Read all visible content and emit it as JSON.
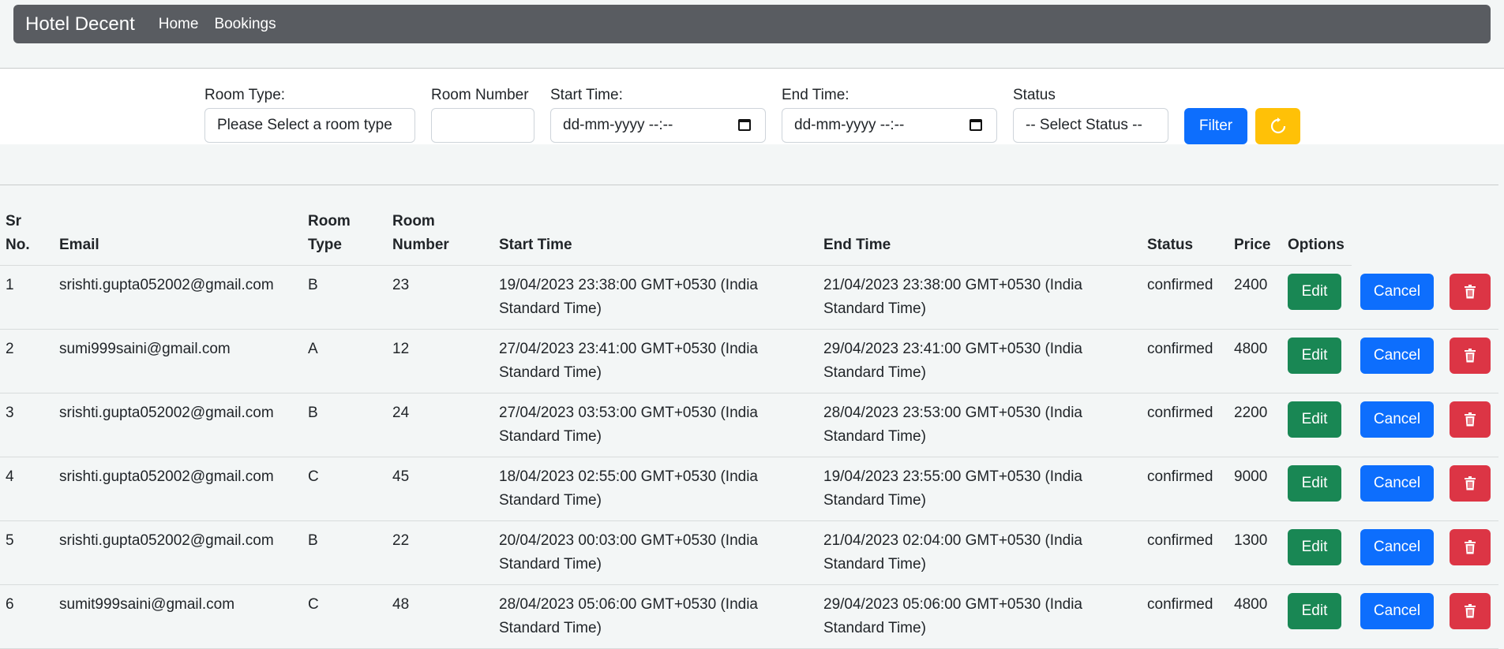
{
  "navbar": {
    "brand": "Hotel Decent",
    "links": [
      "Home",
      "Bookings"
    ]
  },
  "filters": {
    "room_type_label": "Room Type:",
    "room_type_placeholder": "Please Select a room type",
    "room_number_label": "Room Number",
    "room_number_value": "",
    "start_time_label": "Start Time:",
    "start_time_placeholder": "dd-mm-yyyy --:--",
    "end_time_label": "End Time:",
    "end_time_placeholder": "dd-mm-yyyy --:--",
    "status_label": "Status",
    "status_placeholder": "-- Select Status --",
    "filter_button": "Filter",
    "reset_icon": "refresh-icon"
  },
  "table": {
    "headers": {
      "sr_line1": "Sr",
      "sr_line2": "No.",
      "email": "Email",
      "room_type_line1": "Room",
      "room_type_line2": "Type",
      "room_number_line1": "Room",
      "room_number_line2": "Number",
      "start_time": "Start Time",
      "end_time": "End Time",
      "status": "Status",
      "price": "Price",
      "options": "Options"
    },
    "button_labels": {
      "edit": "Edit",
      "cancel": "Cancel",
      "delete_icon": "trash-icon"
    },
    "rows": [
      {
        "sr": "1",
        "email": "srishti.gupta052002@gmail.com",
        "room_type": "B",
        "room_number": "23",
        "start_line1": "19/04/2023 23:38:00 GMT+0530 (India",
        "start_line2": "Standard Time)",
        "end_line1": "21/04/2023 23:38:00 GMT+0530 (India",
        "end_line2": "Standard Time)",
        "status": "confirmed",
        "price": "2400"
      },
      {
        "sr": "2",
        "email": "sumi999saini@gmail.com",
        "room_type": "A",
        "room_number": "12",
        "start_line1": "27/04/2023 23:41:00 GMT+0530 (India",
        "start_line2": "Standard Time)",
        "end_line1": "29/04/2023 23:41:00 GMT+0530 (India",
        "end_line2": "Standard Time)",
        "status": "confirmed",
        "price": "4800"
      },
      {
        "sr": "3",
        "email": "srishti.gupta052002@gmail.com",
        "room_type": "B",
        "room_number": "24",
        "start_line1": "27/04/2023 03:53:00 GMT+0530 (India",
        "start_line2": "Standard Time)",
        "end_line1": "28/04/2023 23:53:00 GMT+0530 (India",
        "end_line2": "Standard Time)",
        "status": "confirmed",
        "price": "2200"
      },
      {
        "sr": "4",
        "email": "srishti.gupta052002@gmail.com",
        "room_type": "C",
        "room_number": "45",
        "start_line1": "18/04/2023 02:55:00 GMT+0530 (India",
        "start_line2": "Standard Time)",
        "end_line1": "19/04/2023 23:55:00 GMT+0530 (India",
        "end_line2": "Standard Time)",
        "status": "confirmed",
        "price": "9000"
      },
      {
        "sr": "5",
        "email": "srishti.gupta052002@gmail.com",
        "room_type": "B",
        "room_number": "22",
        "start_line1": "20/04/2023 00:03:00 GMT+0530 (India",
        "start_line2": "Standard Time)",
        "end_line1": "21/04/2023 02:04:00 GMT+0530 (India",
        "end_line2": "Standard Time)",
        "status": "confirmed",
        "price": "1300"
      },
      {
        "sr": "6",
        "email": "sumit999saini@gmail.com",
        "room_type": "C",
        "room_number": "48",
        "start_line1": "28/04/2023 05:06:00 GMT+0530 (India",
        "start_line2": "Standard Time)",
        "end_line1": "29/04/2023 05:06:00 GMT+0530 (India",
        "end_line2": "Standard Time)",
        "status": "confirmed",
        "price": "4800"
      }
    ]
  },
  "colors": {
    "navbar": "#595c61",
    "primary": "#0d6efd",
    "success": "#198754",
    "danger": "#dc3545",
    "warning": "#ffc107"
  }
}
